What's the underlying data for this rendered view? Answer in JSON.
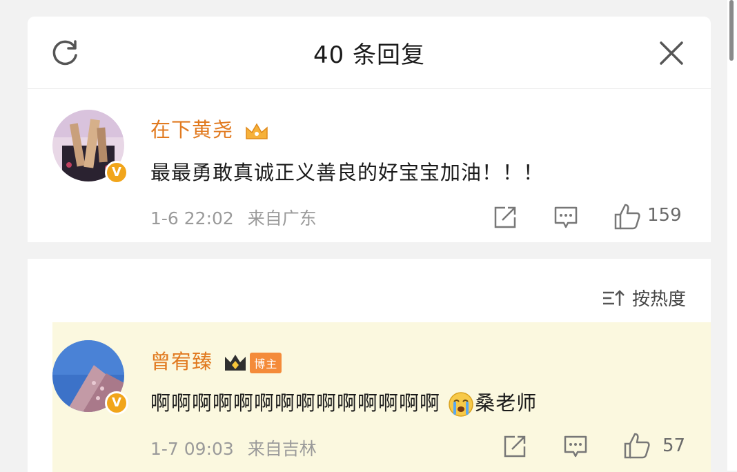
{
  "header": {
    "title": "40 条回复",
    "refresh_icon": "refresh-icon",
    "close_icon": "close-icon"
  },
  "main_comment": {
    "username": "在下黄尧",
    "badge_icon": "crown-member-icon",
    "text": "最最勇敢真诚正义善良的好宝宝加油！！！",
    "timestamp": "1-6 22:02",
    "location": "来自广东",
    "likes": "159",
    "verified": true
  },
  "sort": {
    "label": "按热度",
    "icon": "sort-icon"
  },
  "reply": {
    "username": "曾宥臻",
    "badge_icon": "crown-member-icon",
    "author_tag": "博主",
    "text": "啊啊啊啊啊啊啊啊啊啊啊啊啊啊",
    "emoji": "crying-face-icon",
    "text_suffix": "桑老师",
    "timestamp": "1-7 09:03",
    "location": "来自吉林",
    "likes": "57",
    "verified": true
  },
  "colors": {
    "username": "#e17a20",
    "verified_badge": "#f1a51b",
    "reply_highlight": "#fbf8df",
    "meta_text": "#9a9a9a"
  }
}
